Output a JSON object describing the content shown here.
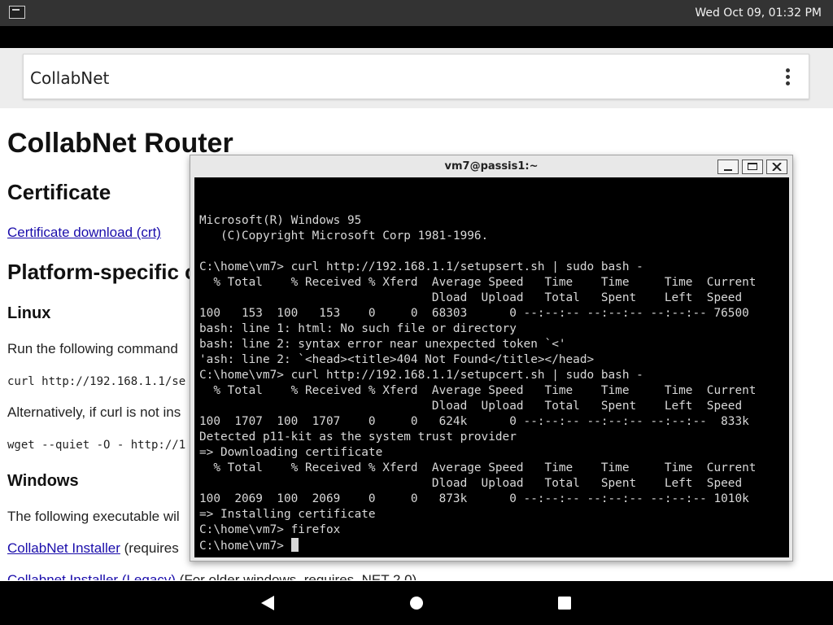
{
  "status_bar": {
    "clock": "Wed Oct 09, 01:32 PM",
    "icon": "terminal-icon"
  },
  "browser": {
    "app_title": "CollabNet",
    "menu_icon": "more-vert-icon"
  },
  "page": {
    "title": "CollabNet Router",
    "cert_heading": "Certificate",
    "cert_link": "Certificate download (crt)",
    "platform_heading": "Platform-specific c",
    "linux_heading": "Linux",
    "linux_text": "Run the following command",
    "linux_curl": "curl http://192.168.1.1/se",
    "linux_alt": "Alternatively, if curl is not ins",
    "linux_wget": "wget --quiet -O - http://1",
    "windows_heading": "Windows",
    "windows_text": "The following executable wil",
    "installer_link": "CollabNet Installer",
    "installer_suffix": " (requires",
    "legacy_link": "Collabnet Installer (Legacy)",
    "legacy_suffix": " (For older windows, requires .NET 2.0)"
  },
  "terminal": {
    "title": "vm7@passis1:~",
    "lines": [
      "Microsoft(R) Windows 95",
      "   (C)Copyright Microsoft Corp 1981-1996.",
      "",
      "C:\\home\\vm7> curl http://192.168.1.1/setupsert.sh | sudo bash -",
      "  % Total    % Received % Xferd  Average Speed   Time    Time     Time  Current",
      "                                 Dload  Upload   Total   Spent    Left  Speed",
      "100   153  100   153    0     0  68303      0 --:--:-- --:--:-- --:--:-- 76500",
      "bash: line 1: html: No such file or directory",
      "bash: line 2: syntax error near unexpected token `<'",
      "'ash: line 2: `<head><title>404 Not Found</title></head>",
      "C:\\home\\vm7> curl http://192.168.1.1/setupcert.sh | sudo bash -",
      "  % Total    % Received % Xferd  Average Speed   Time    Time     Time  Current",
      "                                 Dload  Upload   Total   Spent    Left  Speed",
      "100  1707  100  1707    0     0   624k      0 --:--:-- --:--:-- --:--:--  833k",
      "Detected p11-kit as the system trust provider",
      "=> Downloading certificate",
      "  % Total    % Received % Xferd  Average Speed   Time    Time     Time  Current",
      "                                 Dload  Upload   Total   Spent    Left  Speed",
      "100  2069  100  2069    0     0   873k      0 --:--:-- --:--:-- --:--:-- 1010k",
      "=> Installing certificate",
      "C:\\home\\vm7> firefox"
    ],
    "prompt": "C:\\home\\vm7> "
  },
  "nav_bar": {
    "back": "back-icon",
    "home": "home-icon",
    "recents": "recents-icon"
  }
}
